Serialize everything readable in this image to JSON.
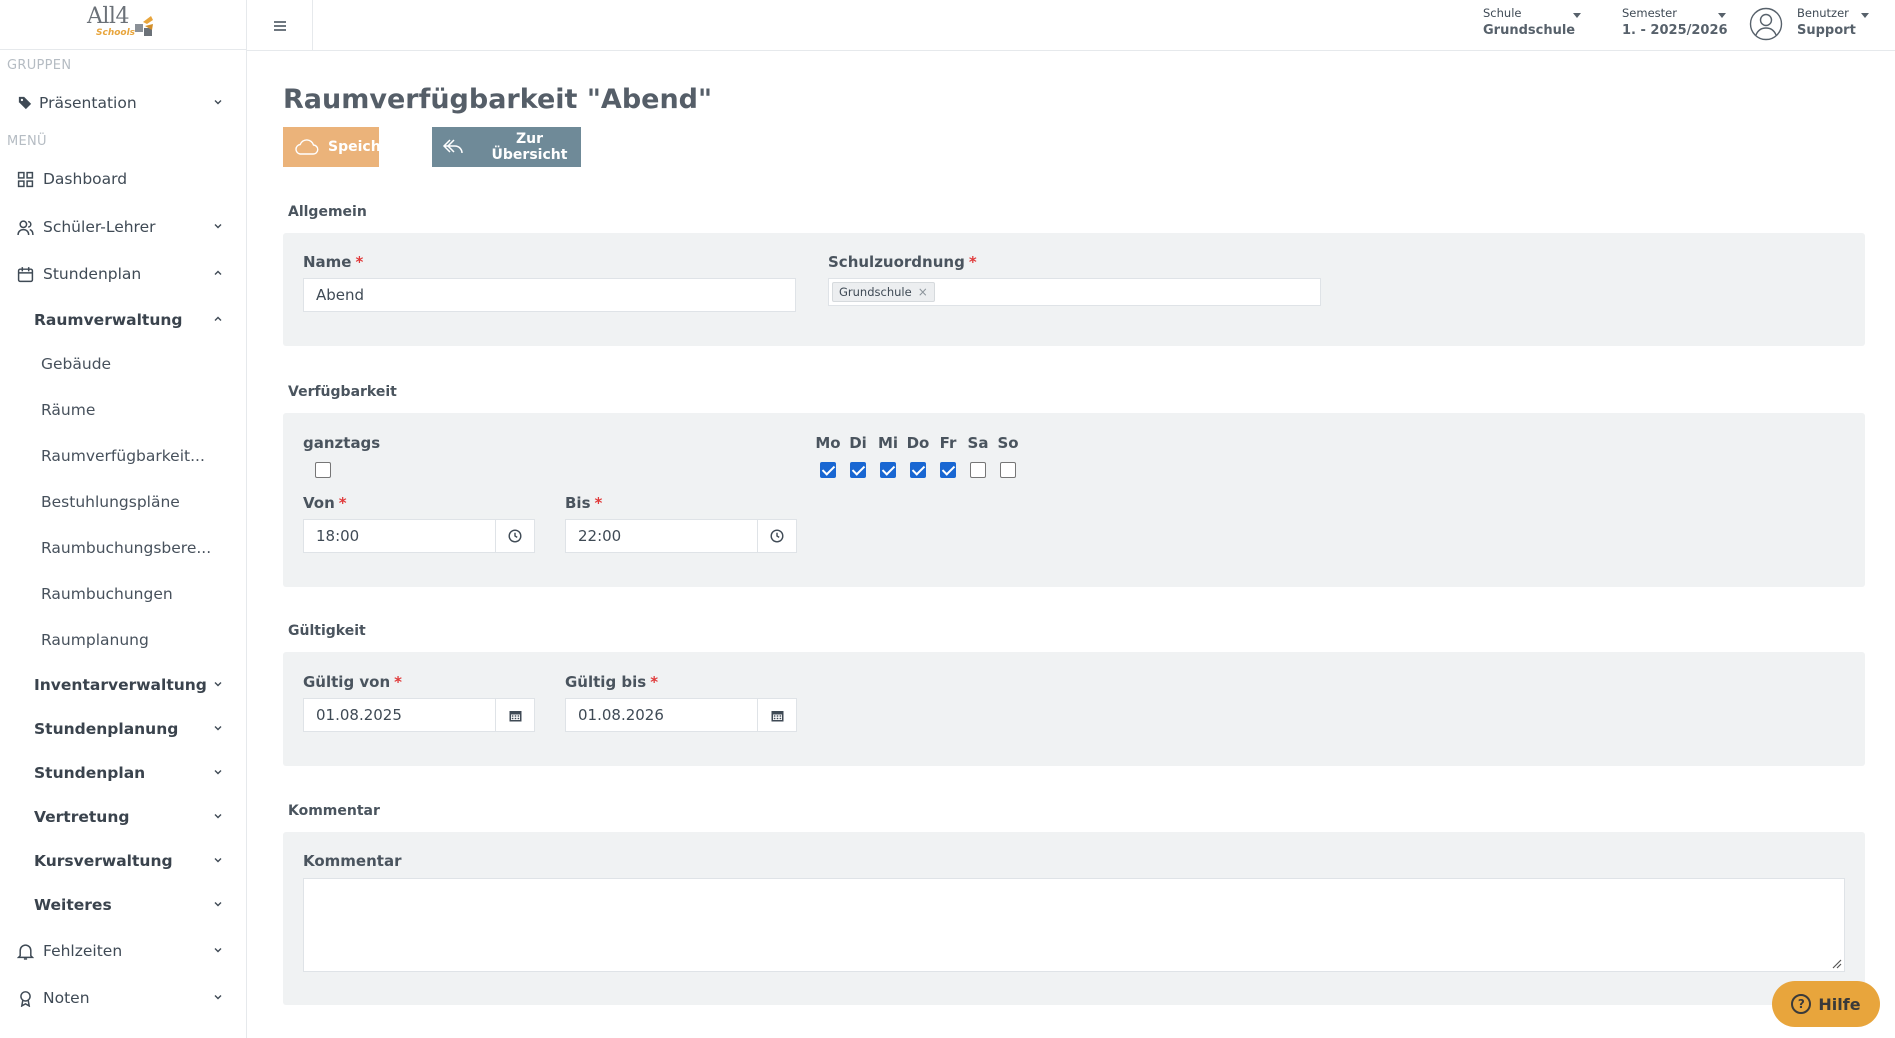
{
  "app": {
    "logo_text": "All4",
    "logo_sub": "Schools"
  },
  "sidebar": {
    "group_label": "GRUPPEN",
    "group_item": "Präsentation",
    "menu_label": "MENÜ",
    "items": [
      {
        "label": "Dashboard",
        "icon": "grid-icon"
      },
      {
        "label": "Schüler-Lehrer",
        "icon": "users-icon"
      },
      {
        "label": "Stundenplan",
        "icon": "calendar-icon"
      },
      {
        "label": "Raumverwaltung"
      },
      {
        "label": "Gebäude"
      },
      {
        "label": "Räume"
      },
      {
        "label": "Raumverfügbarkeit..."
      },
      {
        "label": "Bestuhlungspläne"
      },
      {
        "label": "Raumbuchungsbere..."
      },
      {
        "label": "Raumbuchungen"
      },
      {
        "label": "Raumplanung"
      },
      {
        "label": "Inventarverwaltung"
      },
      {
        "label": "Stundenplanung"
      },
      {
        "label": "Stundenplan"
      },
      {
        "label": "Vertretung"
      },
      {
        "label": "Kursverwaltung"
      },
      {
        "label": "Weiteres"
      },
      {
        "label": "Fehlzeiten",
        "icon": "bell-icon"
      },
      {
        "label": "Noten",
        "icon": "award-icon"
      }
    ]
  },
  "topbar": {
    "school_caption": "Schule",
    "school_value": "Grundschule",
    "semester_caption": "Semester",
    "semester_value": "1. - 2025/2026",
    "user_caption": "Benutzer",
    "user_value": "Support"
  },
  "page": {
    "title": "Raumverfügbarkeit \"Abend\"",
    "save_label": "Speichern",
    "back_label": "Zur Übersicht"
  },
  "general": {
    "section_title": "Allgemein",
    "name_label": "Name",
    "name_value": "Abend",
    "school_label": "Schulzuordnung",
    "school_tag": "Grundschule",
    "tag_remove": "×"
  },
  "availability": {
    "section_title": "Verfügbarkeit",
    "allday_label": "ganztags",
    "allday_checked": false,
    "days": [
      {
        "label": "Mo",
        "checked": true
      },
      {
        "label": "Di",
        "checked": true
      },
      {
        "label": "Mi",
        "checked": true
      },
      {
        "label": "Do",
        "checked": true
      },
      {
        "label": "Fr",
        "checked": true
      },
      {
        "label": "Sa",
        "checked": false
      },
      {
        "label": "So",
        "checked": false
      }
    ],
    "from_label": "Von",
    "from_value": "18:00",
    "to_label": "Bis",
    "to_value": "22:00"
  },
  "validity": {
    "section_title": "Gültigkeit",
    "from_label": "Gültig von",
    "from_value": "01.08.2025",
    "to_label": "Gültig bis",
    "to_value": "01.08.2026"
  },
  "comment": {
    "section_title": "Kommentar",
    "field_label": "Kommentar",
    "value": ""
  },
  "help": {
    "label": "Hilfe",
    "icon_glyph": "?"
  },
  "required_mark": "*",
  "colors": {
    "accent_orange": "#ebb37a",
    "secondary_gray": "#6f8a98",
    "required_red": "#e03a3a",
    "checkbox_blue": "#1967d2"
  }
}
